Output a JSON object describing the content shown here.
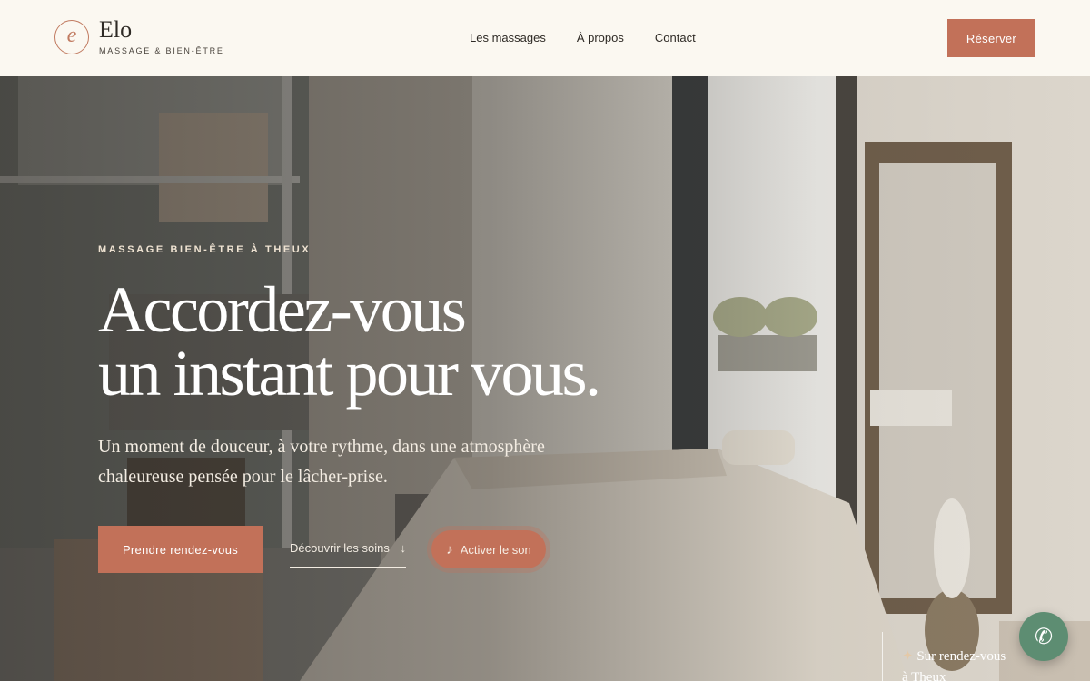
{
  "brand": {
    "mark": "e",
    "name": "Elo",
    "tagline": "MASSAGE & BIEN-ÊTRE"
  },
  "nav": {
    "items": [
      {
        "label": "Les massages"
      },
      {
        "label": "À propos"
      },
      {
        "label": "Contact"
      }
    ],
    "cta_label": "Réserver"
  },
  "hero": {
    "eyebrow": "MASSAGE BIEN-ÊTRE À THEUX",
    "title_line1": "Accordez-vous",
    "title_line2": "un instant pour vous.",
    "subtitle": "Un moment de douceur, à votre rythme, dans une atmosphère chaleureuse pensée pour le lâcher-prise.",
    "primary_button": "Prendre rendez-vous",
    "discover_link": "Découvrir les soins",
    "discover_arrow": "↓",
    "sound_button": "Activer le son",
    "sound_icon": "♪",
    "appointment_star": "✦",
    "appointment_line1": "Sur rendez-vous",
    "appointment_line2": "à Theux"
  },
  "floating": {
    "phone_icon": "✆"
  },
  "colors": {
    "accent": "#c27159",
    "background": "#fbf8f1",
    "phone_button": "#5d8d72"
  }
}
